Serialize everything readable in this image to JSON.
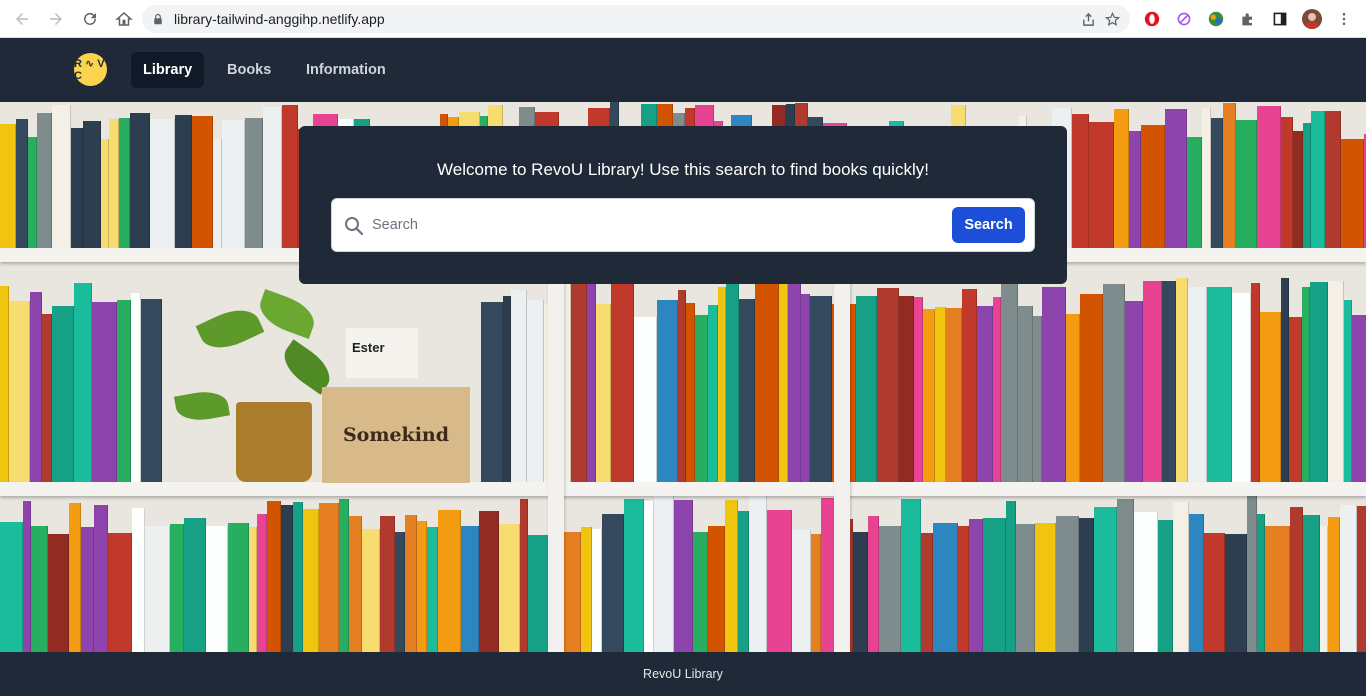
{
  "browser": {
    "url": "library-tailwind-anggihp.netlify.app",
    "icons": [
      "back-icon",
      "forward-icon",
      "reload-icon",
      "home-icon",
      "lock-icon",
      "share-icon",
      "star-icon",
      "extension-icon",
      "puzzle-icon",
      "sidepanel-icon",
      "profile-avatar",
      "menu-icon"
    ]
  },
  "navbar": {
    "logo_text": "R ∿ V C",
    "links": [
      {
        "label": "Library",
        "active": true
      },
      {
        "label": "Books",
        "active": false
      },
      {
        "label": "Information",
        "active": false
      }
    ]
  },
  "hero": {
    "box_label": "Somekind",
    "ester_label": "Ester",
    "search": {
      "title": "Welcome to RevoU Library! Use this search to find books quickly!",
      "placeholder": "Search",
      "button_label": "Search"
    }
  },
  "footer": {
    "text": "RevoU Library"
  },
  "colors": {
    "nav_bg": "#1f2937",
    "nav_active_bg": "#111827",
    "button_blue": "#1d4ed8",
    "logo_yellow": "#fcd34d"
  }
}
